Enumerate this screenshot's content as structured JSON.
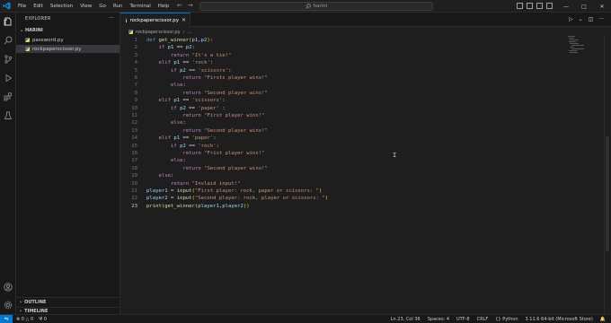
{
  "titlebar": {
    "menu": [
      "File",
      "Edit",
      "Selection",
      "View",
      "Go",
      "Run",
      "Terminal",
      "Help"
    ],
    "search_text": "harini",
    "back_icon": "arrow-left-icon",
    "forward_icon": "arrow-right-icon"
  },
  "sidebar": {
    "title": "EXPLORER",
    "folder": "HARINI",
    "files": [
      {
        "name": "password.py",
        "active": false
      },
      {
        "name": "rockpaperscissor.py",
        "active": true
      }
    ],
    "outline_label": "OUTLINE",
    "timeline_label": "TIMELINE"
  },
  "editor": {
    "tab_label": "rockpaperscissor.py",
    "breadcrumb_file": "rockpaperscissor.py",
    "breadcrumb_symbol": "...",
    "current_line": 23
  },
  "code_lines": [
    "def get_winner(p1,p2):",
    "    if p1 == p2:",
    "        return \"It's a tie!\"",
    "    elif p1 == 'rock':",
    "        if p2 == 'scissors':",
    "            return \"Firsts player wins!\"",
    "        else:",
    "            return \"Second player wins!\"",
    "    elif p1 == 'scissors':",
    "        if p2 == 'paper' :",
    "            return \"First player wins!\"",
    "        else:",
    "            return \"Second player wins!\"",
    "    elif p1 == 'paper':",
    "        if p2 == 'rock':",
    "            return \"Frist player wins!\"",
    "        else:",
    "            return \"Second player wins!\"",
    "    else:",
    "        return \"Invlaid input!\"",
    "player1 = input(\"First player: rock, paper or scissors: \")",
    "player2 = input(\"Second player: rock, player or scissors: \")",
    "print(get_winner(player1,player2))"
  ],
  "statusbar": {
    "errors": "0",
    "warnings": "0",
    "ports": "0",
    "position": "Ln 23, Col 36",
    "spaces": "Spaces: 4",
    "encoding": "UTF-8",
    "eol": "CRLF",
    "language": "Python",
    "interpreter": "3.11.6 64-bit (Microsoft Store)"
  },
  "colors": {
    "accent": "#0078d4",
    "editor_bg": "#1e1e1e",
    "sidebar_bg": "#181818"
  }
}
